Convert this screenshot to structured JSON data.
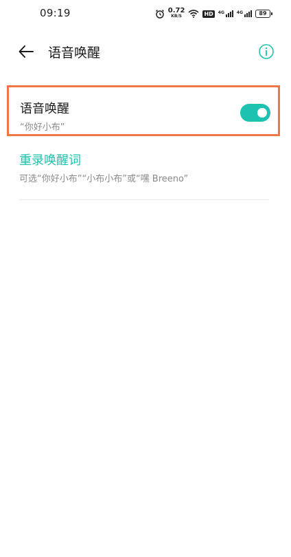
{
  "status_bar": {
    "time": "09:19",
    "net_speed_value": "0.72",
    "net_speed_unit": "KB/S",
    "hd_label": "HD",
    "signal_1_label": "4G",
    "signal_2_label": "4G",
    "battery_level": "89"
  },
  "header": {
    "back_icon": "arrow-left-icon",
    "title": "语音唤醒",
    "info_icon": "info-circle-icon"
  },
  "settings": {
    "voice_wake": {
      "title": "语音唤醒",
      "subtitle": "“你好小布”",
      "enabled": true
    },
    "rerecord": {
      "title": "重录唤醒词",
      "description": "可选“你好小布”“小布小布”或“嘿 Breeno”"
    }
  },
  "colors": {
    "accent": "#1dc2b0",
    "highlight_border": "#f07646",
    "secondary_text": "#8a8a8a"
  }
}
